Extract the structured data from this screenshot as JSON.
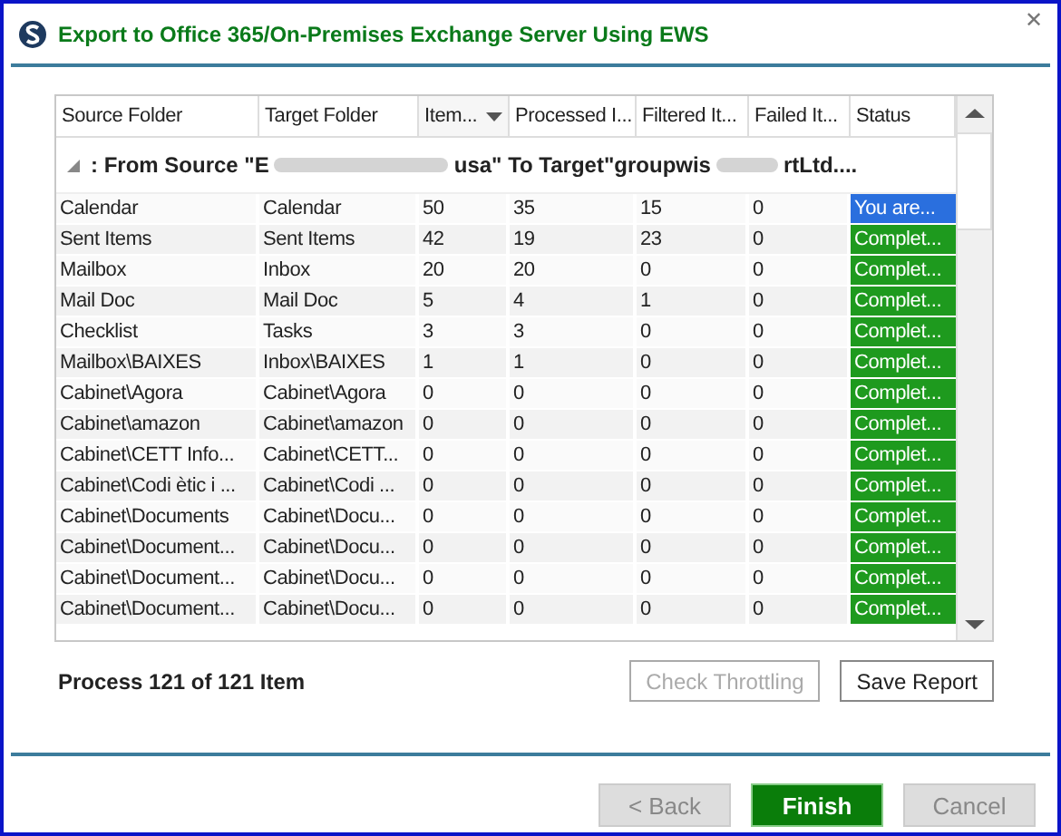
{
  "window": {
    "title": "Export to Office 365/On-Premises Exchange Server Using EWS",
    "close_glyph": "✕"
  },
  "table": {
    "columns": [
      {
        "label": "Source Folder",
        "sorted": false
      },
      {
        "label": "Target Folder",
        "sorted": false
      },
      {
        "label": "Item...",
        "sorted": true
      },
      {
        "label": "Processed I...",
        "sorted": false
      },
      {
        "label": "Filtered It...",
        "sorted": false
      },
      {
        "label": "Failed It...",
        "sorted": false
      },
      {
        "label": "Status",
        "sorted": false
      }
    ],
    "group": {
      "expanded": true,
      "parts": [
        ": From Source \"E",
        "usa\" To Target\"groupwis",
        "rtLtd...."
      ]
    },
    "rows": [
      {
        "cells": [
          "Calendar",
          "Calendar",
          "50",
          "35",
          "15",
          "0"
        ],
        "status": "You are...",
        "selected": true
      },
      {
        "cells": [
          "Sent Items",
          "Sent Items",
          "42",
          "19",
          "23",
          "0"
        ],
        "status": "Complet...",
        "selected": false
      },
      {
        "cells": [
          "Mailbox",
          "Inbox",
          "20",
          "20",
          "0",
          "0"
        ],
        "status": "Complet...",
        "selected": false
      },
      {
        "cells": [
          "Mail Doc",
          "Mail Doc",
          "5",
          "4",
          "1",
          "0"
        ],
        "status": "Complet...",
        "selected": false
      },
      {
        "cells": [
          "Checklist",
          "Tasks",
          "3",
          "3",
          "0",
          "0"
        ],
        "status": "Complet...",
        "selected": false
      },
      {
        "cells": [
          "Mailbox\\BAIXES",
          "Inbox\\BAIXES",
          "1",
          "1",
          "0",
          "0"
        ],
        "status": "Complet...",
        "selected": false
      },
      {
        "cells": [
          "Cabinet\\Agora",
          "Cabinet\\Agora",
          "0",
          "0",
          "0",
          "0"
        ],
        "status": "Complet...",
        "selected": false
      },
      {
        "cells": [
          "Cabinet\\amazon",
          "Cabinet\\amazon",
          "0",
          "0",
          "0",
          "0"
        ],
        "status": "Complet...",
        "selected": false
      },
      {
        "cells": [
          "Cabinet\\CETT Info...",
          "Cabinet\\CETT...",
          "0",
          "0",
          "0",
          "0"
        ],
        "status": "Complet...",
        "selected": false
      },
      {
        "cells": [
          "Cabinet\\Codi ètic i ...",
          "Cabinet\\Codi ...",
          "0",
          "0",
          "0",
          "0"
        ],
        "status": "Complet...",
        "selected": false
      },
      {
        "cells": [
          "Cabinet\\Documents",
          "Cabinet\\Docu...",
          "0",
          "0",
          "0",
          "0"
        ],
        "status": "Complet...",
        "selected": false
      },
      {
        "cells": [
          "Cabinet\\Document...",
          "Cabinet\\Docu...",
          "0",
          "0",
          "0",
          "0"
        ],
        "status": "Complet...",
        "selected": false
      },
      {
        "cells": [
          "Cabinet\\Document...",
          "Cabinet\\Docu...",
          "0",
          "0",
          "0",
          "0"
        ],
        "status": "Complet...",
        "selected": false
      },
      {
        "cells": [
          "Cabinet\\Document...",
          "Cabinet\\Docu...",
          "0",
          "0",
          "0",
          "0"
        ],
        "status": "Complet...",
        "selected": false
      }
    ]
  },
  "progress_text": "Process 121 of 121 Item",
  "report_buttons": [
    {
      "label": "Check Throttling",
      "disabled": true
    },
    {
      "label": "Save Report",
      "disabled": false
    }
  ],
  "nav_buttons": [
    {
      "label": "< Back",
      "kind": "secondary",
      "disabled": true
    },
    {
      "label": "Finish",
      "kind": "primary",
      "disabled": false
    },
    {
      "label": "Cancel",
      "kind": "secondary",
      "disabled": true
    }
  ]
}
